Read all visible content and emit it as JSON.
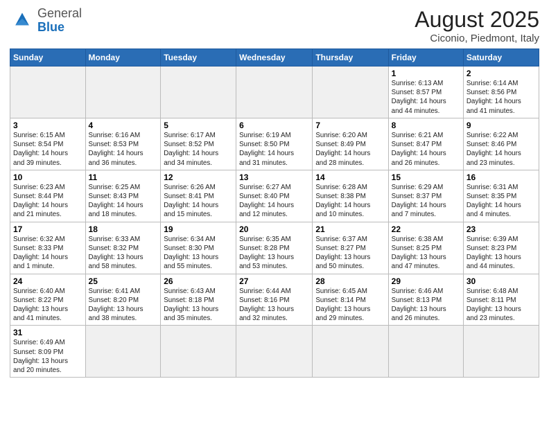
{
  "header": {
    "logo_general": "General",
    "logo_blue": "Blue",
    "title": "August 2025",
    "subtitle": "Ciconio, Piedmont, Italy"
  },
  "days_of_week": [
    "Sunday",
    "Monday",
    "Tuesday",
    "Wednesday",
    "Thursday",
    "Friday",
    "Saturday"
  ],
  "weeks": [
    [
      {
        "day": "",
        "info": "",
        "empty": true
      },
      {
        "day": "",
        "info": "",
        "empty": true
      },
      {
        "day": "",
        "info": "",
        "empty": true
      },
      {
        "day": "",
        "info": "",
        "empty": true
      },
      {
        "day": "",
        "info": "",
        "empty": true
      },
      {
        "day": "1",
        "info": "Sunrise: 6:13 AM\nSunset: 8:57 PM\nDaylight: 14 hours\nand 44 minutes."
      },
      {
        "day": "2",
        "info": "Sunrise: 6:14 AM\nSunset: 8:56 PM\nDaylight: 14 hours\nand 41 minutes."
      }
    ],
    [
      {
        "day": "3",
        "info": "Sunrise: 6:15 AM\nSunset: 8:54 PM\nDaylight: 14 hours\nand 39 minutes."
      },
      {
        "day": "4",
        "info": "Sunrise: 6:16 AM\nSunset: 8:53 PM\nDaylight: 14 hours\nand 36 minutes."
      },
      {
        "day": "5",
        "info": "Sunrise: 6:17 AM\nSunset: 8:52 PM\nDaylight: 14 hours\nand 34 minutes."
      },
      {
        "day": "6",
        "info": "Sunrise: 6:19 AM\nSunset: 8:50 PM\nDaylight: 14 hours\nand 31 minutes."
      },
      {
        "day": "7",
        "info": "Sunrise: 6:20 AM\nSunset: 8:49 PM\nDaylight: 14 hours\nand 28 minutes."
      },
      {
        "day": "8",
        "info": "Sunrise: 6:21 AM\nSunset: 8:47 PM\nDaylight: 14 hours\nand 26 minutes."
      },
      {
        "day": "9",
        "info": "Sunrise: 6:22 AM\nSunset: 8:46 PM\nDaylight: 14 hours\nand 23 minutes."
      }
    ],
    [
      {
        "day": "10",
        "info": "Sunrise: 6:23 AM\nSunset: 8:44 PM\nDaylight: 14 hours\nand 21 minutes."
      },
      {
        "day": "11",
        "info": "Sunrise: 6:25 AM\nSunset: 8:43 PM\nDaylight: 14 hours\nand 18 minutes."
      },
      {
        "day": "12",
        "info": "Sunrise: 6:26 AM\nSunset: 8:41 PM\nDaylight: 14 hours\nand 15 minutes."
      },
      {
        "day": "13",
        "info": "Sunrise: 6:27 AM\nSunset: 8:40 PM\nDaylight: 14 hours\nand 12 minutes."
      },
      {
        "day": "14",
        "info": "Sunrise: 6:28 AM\nSunset: 8:38 PM\nDaylight: 14 hours\nand 10 minutes."
      },
      {
        "day": "15",
        "info": "Sunrise: 6:29 AM\nSunset: 8:37 PM\nDaylight: 14 hours\nand 7 minutes."
      },
      {
        "day": "16",
        "info": "Sunrise: 6:31 AM\nSunset: 8:35 PM\nDaylight: 14 hours\nand 4 minutes."
      }
    ],
    [
      {
        "day": "17",
        "info": "Sunrise: 6:32 AM\nSunset: 8:33 PM\nDaylight: 14 hours\nand 1 minute."
      },
      {
        "day": "18",
        "info": "Sunrise: 6:33 AM\nSunset: 8:32 PM\nDaylight: 13 hours\nand 58 minutes."
      },
      {
        "day": "19",
        "info": "Sunrise: 6:34 AM\nSunset: 8:30 PM\nDaylight: 13 hours\nand 55 minutes."
      },
      {
        "day": "20",
        "info": "Sunrise: 6:35 AM\nSunset: 8:28 PM\nDaylight: 13 hours\nand 53 minutes."
      },
      {
        "day": "21",
        "info": "Sunrise: 6:37 AM\nSunset: 8:27 PM\nDaylight: 13 hours\nand 50 minutes."
      },
      {
        "day": "22",
        "info": "Sunrise: 6:38 AM\nSunset: 8:25 PM\nDaylight: 13 hours\nand 47 minutes."
      },
      {
        "day": "23",
        "info": "Sunrise: 6:39 AM\nSunset: 8:23 PM\nDaylight: 13 hours\nand 44 minutes."
      }
    ],
    [
      {
        "day": "24",
        "info": "Sunrise: 6:40 AM\nSunset: 8:22 PM\nDaylight: 13 hours\nand 41 minutes."
      },
      {
        "day": "25",
        "info": "Sunrise: 6:41 AM\nSunset: 8:20 PM\nDaylight: 13 hours\nand 38 minutes."
      },
      {
        "day": "26",
        "info": "Sunrise: 6:43 AM\nSunset: 8:18 PM\nDaylight: 13 hours\nand 35 minutes."
      },
      {
        "day": "27",
        "info": "Sunrise: 6:44 AM\nSunset: 8:16 PM\nDaylight: 13 hours\nand 32 minutes."
      },
      {
        "day": "28",
        "info": "Sunrise: 6:45 AM\nSunset: 8:14 PM\nDaylight: 13 hours\nand 29 minutes."
      },
      {
        "day": "29",
        "info": "Sunrise: 6:46 AM\nSunset: 8:13 PM\nDaylight: 13 hours\nand 26 minutes."
      },
      {
        "day": "30",
        "info": "Sunrise: 6:48 AM\nSunset: 8:11 PM\nDaylight: 13 hours\nand 23 minutes."
      }
    ],
    [
      {
        "day": "31",
        "info": "Sunrise: 6:49 AM\nSunset: 8:09 PM\nDaylight: 13 hours\nand 20 minutes."
      },
      {
        "day": "",
        "info": "",
        "empty": true
      },
      {
        "day": "",
        "info": "",
        "empty": true
      },
      {
        "day": "",
        "info": "",
        "empty": true
      },
      {
        "day": "",
        "info": "",
        "empty": true
      },
      {
        "day": "",
        "info": "",
        "empty": true
      },
      {
        "day": "",
        "info": "",
        "empty": true
      }
    ]
  ]
}
